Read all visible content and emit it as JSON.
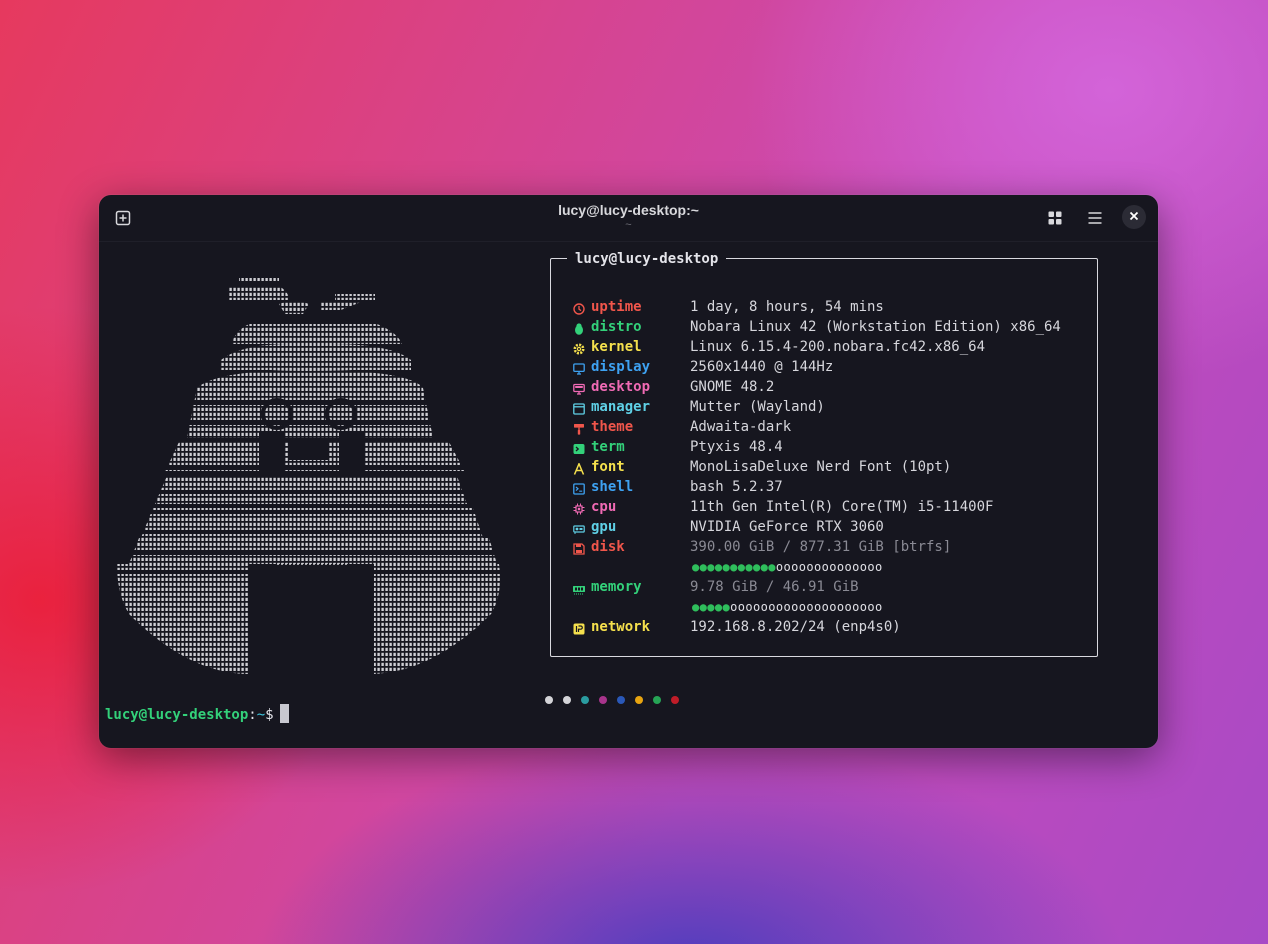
{
  "window": {
    "title": "lucy@lucy-desktop:~",
    "subtitle": "~",
    "icons": {
      "new_tab": "new-tab-icon",
      "overview": "tab-overview-icon",
      "menu": "hamburger-menu-icon",
      "close": "close-icon"
    }
  },
  "fetch": {
    "header": "lucy@lucy-desktop",
    "rows": [
      {
        "icon": "clock-icon",
        "key": "uptime",
        "value": "1 day, 8 hours, 54 mins",
        "color": "#f0564b"
      },
      {
        "icon": "penguin-icon",
        "key": "distro",
        "value": "Nobara Linux 42 (Workstation Edition) x86_64",
        "color": "#33d17a"
      },
      {
        "icon": "gear-icon",
        "key": "kernel",
        "value": "Linux 6.15.4-200.nobara.fc42.x86_64",
        "color": "#f5e04d"
      },
      {
        "icon": "monitor-icon",
        "key": "display",
        "value": "2560x1440 @ 144Hz",
        "color": "#3ea2f2"
      },
      {
        "icon": "desktop-icon",
        "key": "desktop",
        "value": "GNOME 48.2",
        "color": "#f06ab4"
      },
      {
        "icon": "window-icon",
        "key": "manager",
        "value": "Mutter (Wayland)",
        "color": "#5fd0e6"
      },
      {
        "icon": "paint-roller-icon",
        "key": "theme",
        "value": "Adwaita-dark",
        "color": "#f0564b"
      },
      {
        "icon": "terminal-icon",
        "key": "term",
        "value": "Ptyxis 48.4",
        "color": "#33d17a"
      },
      {
        "icon": "font-icon",
        "key": "font",
        "value": "MonoLisaDeluxe Nerd Font (10pt)",
        "color": "#f5e04d"
      },
      {
        "icon": "shell-icon",
        "key": "shell",
        "value": "bash 5.2.37",
        "color": "#3ea2f2"
      },
      {
        "icon": "cpu-icon",
        "key": "cpu",
        "value": "11th Gen Intel(R) Core(TM) i5-11400F",
        "color": "#f06ab4"
      },
      {
        "icon": "gpu-icon",
        "key": "gpu",
        "value": "NVIDIA GeForce RTX 3060",
        "color": "#5fd0e6"
      },
      {
        "icon": "disk-icon",
        "key": "disk",
        "value": "390.00 GiB / 877.31 GiB [btrfs]",
        "color": "#f0564b",
        "dim": true
      },
      {
        "icon": "memory-icon",
        "key": "memory",
        "value": "9.78 GiB / 46.91 GiB",
        "color": "#33d17a",
        "dim": true
      },
      {
        "icon": "network-icon",
        "key": "network",
        "value": "192.168.8.202/24 (enp4s0)",
        "color": "#f5e04d"
      }
    ],
    "bars": {
      "disk": {
        "filled": 11,
        "empty": 14
      },
      "memory": {
        "filled": 5,
        "empty": 20
      }
    }
  },
  "palette": [
    "#d4d4d8",
    "#d4d4d8",
    "#2a9ca0",
    "#a8348c",
    "#2a58b8",
    "#e8a410",
    "#26a455",
    "#c01c28"
  ],
  "prompt": {
    "user_host": "lucy@lucy-desktop",
    "sep": ":",
    "dir": "~",
    "sym": "$"
  },
  "logo": {
    "name": "ascii-logo"
  }
}
